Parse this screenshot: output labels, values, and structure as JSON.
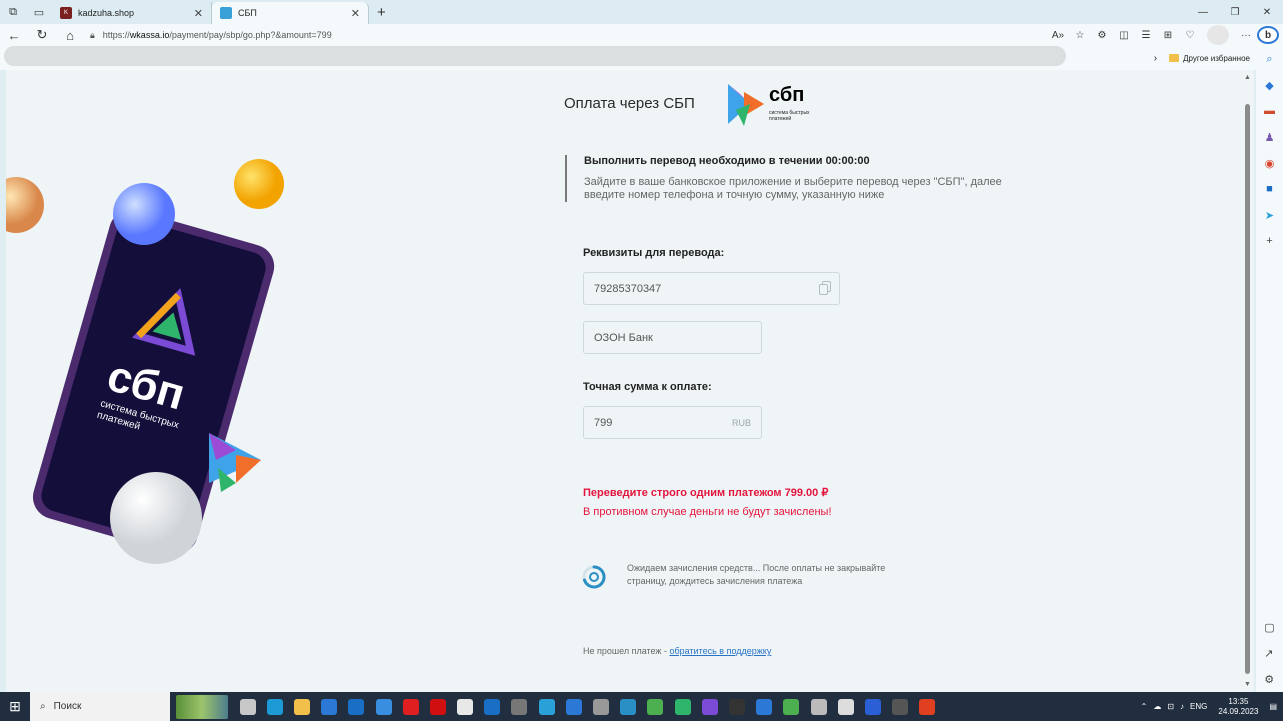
{
  "browser": {
    "tabs": [
      {
        "label": "kadzuha.shop",
        "active": false
      },
      {
        "label": "СБП",
        "active": true
      }
    ],
    "url_prefix": "https://",
    "url_host": "wkassa.io",
    "url_path": "/payment/pay/sbp/go.php?&amount=799",
    "favorites_other": "Другое избранное"
  },
  "page": {
    "heading": "Оплата через СБП",
    "logo_word": "сбп",
    "logo_sub": "система быстрых платежей",
    "notice_title": "Выполнить перевод необходимо в течении 00:00:00",
    "notice_text": "Зайдите в ваше банковское приложение и выберите перевод через \"СБП\", далее введите номер телефона и точную сумму, указанную ниже",
    "requisites_label": "Реквизиты для перевода:",
    "phone": "79285370347",
    "bank": "ОЗОН Банк",
    "amount_label": "Точная сумма к оплате:",
    "amount": "799",
    "currency": "RUB",
    "warning_strong": "Переведите строго одним платежом 799.00 ₽",
    "warning_text": "В противном случае деньги не будут зачислены!",
    "waiting_text": "Ожидаем зачисления средств... После оплаты не закрывайте страницу, дождитесь зачисления платежа",
    "support_prefix": "Не прошел платеж - ",
    "support_link": "обратитесь в поддержку"
  },
  "taskbar": {
    "search_placeholder": "Поиск",
    "lang": "ENG",
    "time": "13:35",
    "date": "24.09.2023"
  },
  "colors": {
    "accent_red": "#e3143c",
    "link": "#2873c6",
    "page_bg": "#eff5f7"
  }
}
